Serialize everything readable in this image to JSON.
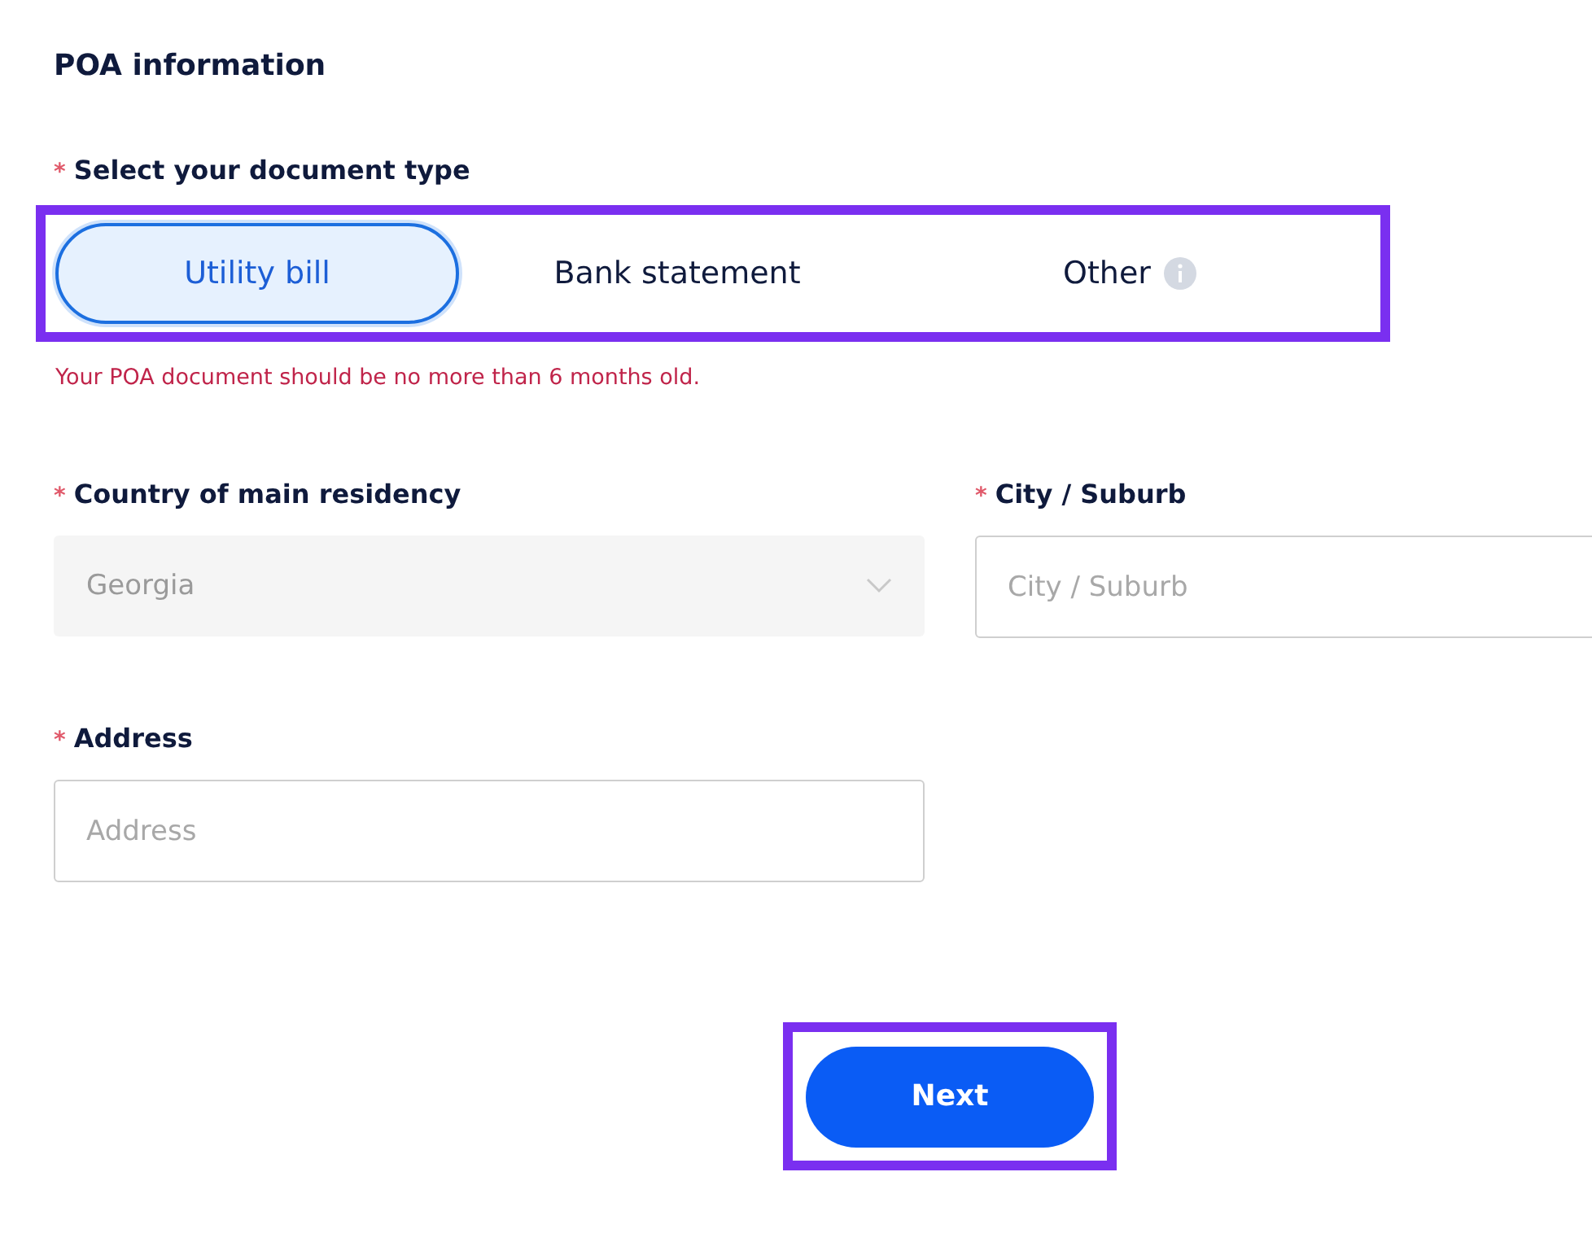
{
  "title": "POA information",
  "document_type": {
    "label": "Select your document type",
    "required_mark": "*",
    "highlighted": true,
    "options": [
      {
        "label": "Utility bill",
        "selected": true,
        "info": false
      },
      {
        "label": "Bank statement",
        "selected": false,
        "info": false
      },
      {
        "label": "Other",
        "selected": false,
        "info": true
      }
    ],
    "hint": "Your POA document should be no more than 6 months old."
  },
  "country": {
    "label": "Country of main residency",
    "required_mark": "*",
    "value": "Georgia",
    "disabled": true
  },
  "city": {
    "label": "City / Suburb",
    "required_mark": "*",
    "placeholder": "City / Suburb"
  },
  "address": {
    "label": "Address",
    "required_mark": "*",
    "placeholder": "Address"
  },
  "next_button": {
    "label": "Next",
    "highlighted": true
  }
}
